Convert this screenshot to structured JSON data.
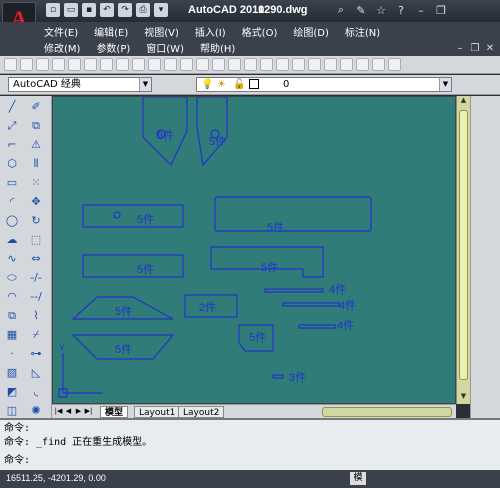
{
  "titlebar": {
    "app_logo": "A",
    "title": "AutoCAD 2010",
    "filename": "1290.dwg"
  },
  "menu": {
    "row1": [
      "文件(E)",
      "编辑(E)",
      "视图(V)",
      "插入(I)",
      "格式(O)",
      "绘图(D)",
      "标注(N)"
    ],
    "row2": [
      "修改(M)",
      "参数(P)",
      "窗口(W)",
      "帮助(H)"
    ]
  },
  "workspace": {
    "value": "AutoCAD 经典"
  },
  "layer": {
    "value": "0"
  },
  "drawing": {
    "labels": [
      "5件",
      "5件",
      "5件",
      "5件",
      "5件",
      "5件",
      "4件",
      "4件",
      "4件",
      "5件",
      "2件",
      "5件",
      "5件",
      "3件"
    ]
  },
  "tabs": {
    "model": "模型",
    "layout1": "Layout1",
    "layout2": "Layout2"
  },
  "command": {
    "line1": "命令:",
    "line2": "命令: _find 正在重生成模型。",
    "line3": "命令:"
  },
  "status": {
    "coords": "16511.25, -4201.29, 0.00",
    "model_btn": "模"
  },
  "colors": {
    "canvas": "#2f7c78",
    "linework": "#2233cc"
  }
}
